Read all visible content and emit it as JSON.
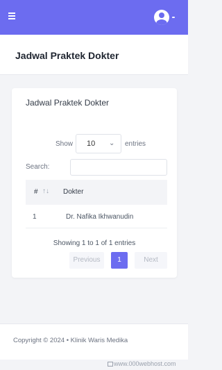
{
  "theme": {
    "accent": "#6c6cf0",
    "background": "#f3f4f7"
  },
  "topbar": {
    "menu_icon": "hamburger-icon",
    "avatar_icon": "user-circle-icon",
    "caret_icon": "caret-down-icon"
  },
  "page": {
    "title": "Jadwal Praktek Dokter"
  },
  "card": {
    "title": "Jadwal Praktek Dokter",
    "length": {
      "show_label": "Show",
      "value": "10",
      "entries_label": "entries",
      "chevron_icon": "chevron-down-icon"
    },
    "search": {
      "label": "Search:",
      "value": ""
    },
    "table": {
      "columns": [
        "#",
        "Dokter"
      ],
      "sort_icon": "sort-icon",
      "rows": [
        {
          "no": "1",
          "dokter": "Dr. Nafika Ikhwanudin"
        }
      ]
    },
    "info": "Showing 1 to 1 of 1 entries",
    "pagination": {
      "previous": "Previous",
      "current": "1",
      "next": "Next"
    }
  },
  "footer": {
    "copyright": "Copyright © 2024 • Klinik Waris Medika"
  },
  "watermark": "www.000webhost.com"
}
